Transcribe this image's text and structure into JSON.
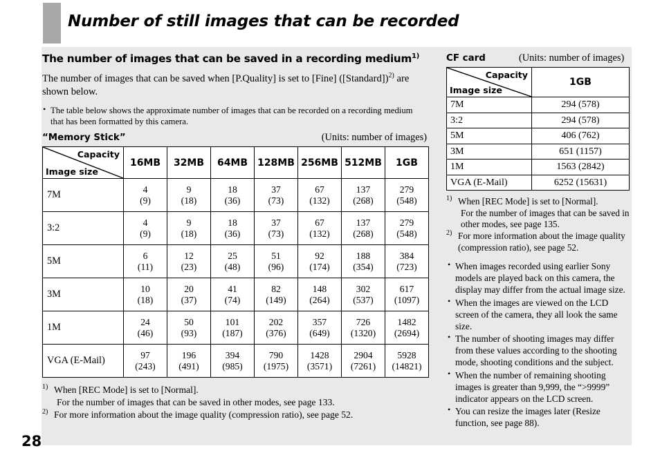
{
  "document": {
    "title": "Number of still images that can be recorded",
    "page_number": "28"
  },
  "left": {
    "section_heading": "The number of images that can be saved in a recording medium",
    "section_heading_sup": "1)",
    "intro_part1": "The number of images that can be saved when [P.Quality] is set to [Fine] ([Standard])",
    "intro_sup": "2)",
    "intro_part2": " are shown below.",
    "bullets": [
      "The table below shows the approximate number of images that can be recorded on a recording medium that has been formatted by this camera."
    ],
    "medium_label": "“Memory Stick”",
    "units_label": "(Units: number of images)",
    "table": {
      "corner_capacity": "Capacity",
      "corner_image_size": "Image size",
      "columns": [
        "16MB",
        "32MB",
        "64MB",
        "128MB",
        "256MB",
        "512MB",
        "1GB"
      ],
      "rows": [
        {
          "label": "7M",
          "fine": [
            "4",
            "9",
            "18",
            "37",
            "67",
            "137",
            "279"
          ],
          "standard": [
            "(9)",
            "(18)",
            "(36)",
            "(73)",
            "(132)",
            "(268)",
            "(548)"
          ]
        },
        {
          "label": "3:2",
          "fine": [
            "4",
            "9",
            "18",
            "37",
            "67",
            "137",
            "279"
          ],
          "standard": [
            "(9)",
            "(18)",
            "(36)",
            "(73)",
            "(132)",
            "(268)",
            "(548)"
          ]
        },
        {
          "label": "5M",
          "fine": [
            "6",
            "12",
            "25",
            "51",
            "92",
            "188",
            "384"
          ],
          "standard": [
            "(11)",
            "(23)",
            "(48)",
            "(96)",
            "(174)",
            "(354)",
            "(723)"
          ]
        },
        {
          "label": "3M",
          "fine": [
            "10",
            "20",
            "41",
            "82",
            "148",
            "302",
            "617"
          ],
          "standard": [
            "(18)",
            "(37)",
            "(74)",
            "(149)",
            "(264)",
            "(537)",
            "(1097)"
          ]
        },
        {
          "label": "1M",
          "fine": [
            "24",
            "50",
            "101",
            "202",
            "357",
            "726",
            "1482"
          ],
          "standard": [
            "(46)",
            "(93)",
            "(187)",
            "(376)",
            "(649)",
            "(1320)",
            "(2694)"
          ]
        },
        {
          "label": "VGA (E-Mail)",
          "fine": [
            "97",
            "196",
            "394",
            "790",
            "1428",
            "2904",
            "5928"
          ],
          "standard": [
            "(243)",
            "(491)",
            "(985)",
            "(1975)",
            "(3571)",
            "(7261)",
            "(14821)"
          ]
        }
      ]
    },
    "footnotes": [
      {
        "marker": "1)",
        "text": "When [REC Mode] is set to [Normal].",
        "continuation": "For the number of images that can be saved in other modes, see page 133."
      },
      {
        "marker": "2)",
        "text": "For more information about the image quality (compression ratio), see page 52.",
        "continuation": ""
      }
    ]
  },
  "right": {
    "medium_label": "CF card",
    "units_label": "(Units: number of images)",
    "table": {
      "corner_capacity": "Capacity",
      "corner_image_size": "Image size",
      "columns": [
        "1GB"
      ],
      "rows": [
        {
          "label": "7M",
          "value": "294 (578)"
        },
        {
          "label": "3:2",
          "value": "294 (578)"
        },
        {
          "label": "5M",
          "value": "406 (762)"
        },
        {
          "label": "3M",
          "value": "651 (1157)"
        },
        {
          "label": "1M",
          "value": "1563 (2842)"
        },
        {
          "label": "VGA (E-Mail)",
          "value": "6252 (15631)"
        }
      ]
    },
    "footnotes": [
      {
        "marker": "1)",
        "text": "When [REC Mode] is set to [Normal].",
        "continuation": "For the number of images that can be saved in other modes, see page 135."
      },
      {
        "marker": "2)",
        "text": "For more information about the image quality (compression ratio), see page 52.",
        "continuation": ""
      }
    ],
    "bullets": [
      "When images recorded using earlier Sony models are played back on this camera, the display may differ from the actual image size.",
      "When the images are viewed on the LCD screen of the camera, they all look the same size.",
      "The number of shooting images may differ from these values according to the shooting mode, shooting conditions and the subject.",
      "When the number of remaining shooting images is greater than 9,999, the “>9999” indicator appears on the LCD screen.",
      "You can resize the images later (Resize function, see page 88)."
    ]
  }
}
